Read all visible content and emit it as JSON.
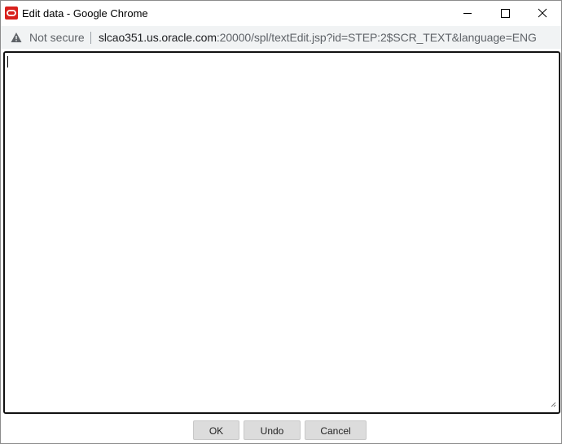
{
  "window": {
    "title": "Edit data - Google Chrome",
    "controls": {
      "minimize": "minimize",
      "maximize": "maximize",
      "close": "close"
    }
  },
  "addressbar": {
    "security_label": "Not secure",
    "url_host": "slcao351.us.oracle.com",
    "url_path": ":20000/spl/textEdit.jsp?id=STEP:2$SCR_TEXT&language=ENG"
  },
  "editor": {
    "value": ""
  },
  "buttons": {
    "ok": "OK",
    "undo": "Undo",
    "cancel": "Cancel"
  },
  "icons": {
    "app": "oracle-logo-icon",
    "warning": "warning-triangle-icon"
  },
  "colors": {
    "app_icon": "#d8201c",
    "addressbar_bg": "#f1f3f4",
    "button_bg": "#dcdcdc"
  }
}
